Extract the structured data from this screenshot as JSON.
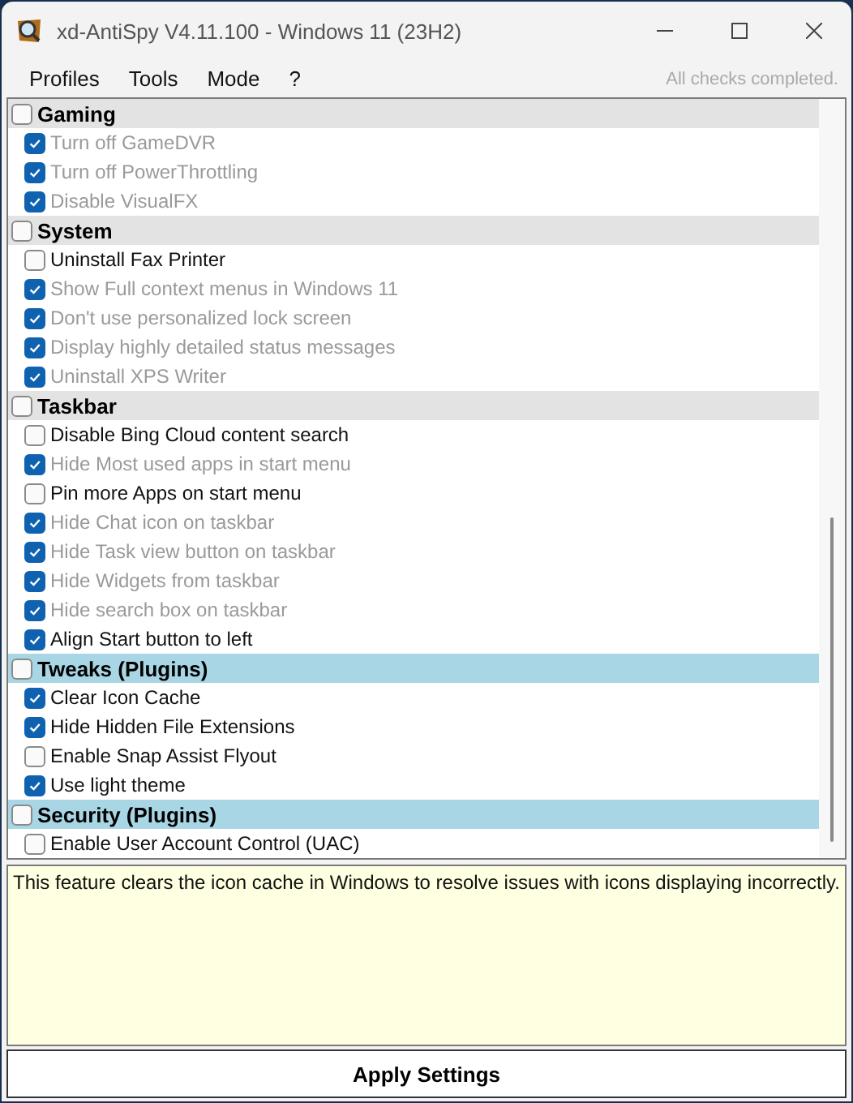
{
  "window": {
    "title": "xd-AntiSpy V4.11.100 - Windows 11 (23H2)"
  },
  "menu": [
    {
      "label": "Profiles"
    },
    {
      "label": "Tools"
    },
    {
      "label": "Mode"
    },
    {
      "label": "?"
    }
  ],
  "status": "All checks completed.",
  "groups": [
    {
      "label": "Gaming",
      "kind": "builtin",
      "checked": false,
      "items": [
        {
          "label": "Turn off GameDVR",
          "checked": true,
          "dimmed": true
        },
        {
          "label": "Turn off PowerThrottling",
          "checked": true,
          "dimmed": true
        },
        {
          "label": "Disable VisualFX",
          "checked": true,
          "dimmed": true
        }
      ]
    },
    {
      "label": "System",
      "kind": "builtin",
      "checked": false,
      "items": [
        {
          "label": "Uninstall Fax Printer",
          "checked": false,
          "dimmed": false
        },
        {
          "label": "Show Full context menus in Windows 11",
          "checked": true,
          "dimmed": true
        },
        {
          "label": "Don't use personalized lock screen",
          "checked": true,
          "dimmed": true
        },
        {
          "label": "Display highly detailed status messages",
          "checked": true,
          "dimmed": true
        },
        {
          "label": "Uninstall XPS Writer",
          "checked": true,
          "dimmed": true
        }
      ]
    },
    {
      "label": "Taskbar",
      "kind": "builtin",
      "checked": false,
      "items": [
        {
          "label": "Disable Bing Cloud content search",
          "checked": false,
          "dimmed": false
        },
        {
          "label": "Hide Most used apps in start menu",
          "checked": true,
          "dimmed": true
        },
        {
          "label": "Pin more Apps on start menu",
          "checked": false,
          "dimmed": false
        },
        {
          "label": "Hide Chat icon on taskbar",
          "checked": true,
          "dimmed": true
        },
        {
          "label": "Hide Task view button on taskbar",
          "checked": true,
          "dimmed": true
        },
        {
          "label": "Hide Widgets from taskbar",
          "checked": true,
          "dimmed": true
        },
        {
          "label": "Hide search box on taskbar",
          "checked": true,
          "dimmed": true
        },
        {
          "label": "Align Start button to left",
          "checked": true,
          "dimmed": false
        }
      ]
    },
    {
      "label": "Tweaks (Plugins)",
      "kind": "plugin",
      "checked": false,
      "items": [
        {
          "label": "Clear Icon Cache",
          "checked": true,
          "dimmed": false
        },
        {
          "label": "Hide Hidden File Extensions",
          "checked": true,
          "dimmed": false
        },
        {
          "label": "Enable Snap Assist Flyout",
          "checked": false,
          "dimmed": false
        },
        {
          "label": "Use light theme",
          "checked": true,
          "dimmed": false
        }
      ]
    },
    {
      "label": "Security (Plugins)",
      "kind": "plugin",
      "checked": false,
      "items": [
        {
          "label": "Enable User Account Control (UAC)",
          "checked": false,
          "dimmed": false
        }
      ]
    }
  ],
  "description": "This feature clears the icon cache in Windows to resolve issues with icons displaying incorrectly.",
  "apply_button": "Apply Settings"
}
